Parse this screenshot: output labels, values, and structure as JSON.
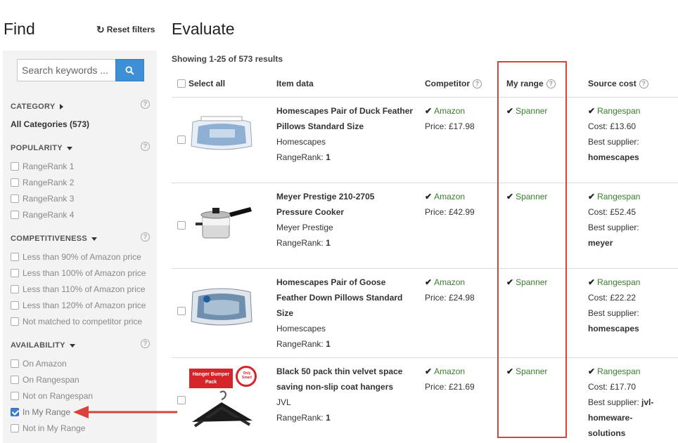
{
  "sidebar": {
    "title": "Find",
    "reset_label": "Reset filters",
    "search_placeholder": "Search keywords ...",
    "category": {
      "heading": "CATEGORY",
      "all": "All Categories (573)"
    },
    "popularity": {
      "heading": "POPULARITY",
      "options": [
        "RangeRank 1",
        "RangeRank 2",
        "RangeRank 3",
        "RangeRank 4"
      ]
    },
    "competitiveness": {
      "heading": "COMPETITIVENESS",
      "options": [
        "Less than 90% of Amazon price",
        "Less than 100% of Amazon price",
        "Less than 110% of Amazon price",
        "Less than 120% of Amazon price",
        "Not matched to competitor price"
      ]
    },
    "availability": {
      "heading": "AVAILABILITY",
      "options": [
        "On Amazon",
        "On Rangespan",
        "Not on Rangespan",
        "In My Range",
        "Not in My Range"
      ]
    },
    "help_glyph": "?"
  },
  "main": {
    "title": "Evaluate",
    "showing": "Showing 1-25 of 573 results",
    "headers": {
      "select_all": "Select all",
      "item_data": "Item data",
      "competitor": "Competitor",
      "my_range": "My range",
      "source_cost": "Source cost"
    },
    "rows": [
      {
        "name_l1": "Homescapes Pair of Duck Feather",
        "name_l2": "Pillows Standard Size",
        "name_l3": "",
        "brand": "Homescapes",
        "rank_label": "RangeRank:",
        "rank": "1",
        "competitor": "Amazon",
        "price": "Price: £17.98",
        "range": "Spanner",
        "source": "Rangespan",
        "cost": "Cost: £13.60",
        "best_label": "Best supplier:",
        "supplier": "homescapes",
        "supplier2": ""
      },
      {
        "name_l1": "Meyer Prestige 210-2705",
        "name_l2": "Pressure Cooker",
        "name_l3": "",
        "brand": "Meyer Prestige",
        "rank_label": "RangeRank:",
        "rank": "1",
        "competitor": "Amazon",
        "price": "Price: £42.99",
        "range": "Spanner",
        "source": "Rangespan",
        "cost": "Cost: £52.45",
        "best_label": "Best supplier:",
        "supplier": "meyer",
        "supplier2": ""
      },
      {
        "name_l1": "Homescapes Pair of Goose",
        "name_l2": "Feather Down Pillows Standard",
        "name_l3": "Size",
        "brand": "Homescapes",
        "rank_label": "RangeRank:",
        "rank": "1",
        "competitor": "Amazon",
        "price": "Price: £24.98",
        "range": "Spanner",
        "source": "Rangespan",
        "cost": "Cost: £22.22",
        "best_label": "Best supplier:",
        "supplier": "homescapes",
        "supplier2": ""
      },
      {
        "name_l1": "Black 50 pack thin velvet space",
        "name_l2": "saving non-slip coat hangers",
        "name_l3": "",
        "brand": "JVL",
        "rank_label": "RangeRank:",
        "rank": "1",
        "competitor": "Amazon",
        "price": "Price: £21.69",
        "range": "Spanner",
        "source": "Rangespan",
        "cost": "Cost: £17.70",
        "best_label": "Best supplier:",
        "supplier": "jvl-",
        "supplier2": "homeware-",
        "supplier3": "solutions"
      }
    ],
    "thumb4_text": {
      "title": "Hanger Bumper Pack",
      "badge": "Only Smart"
    },
    "check_glyph": "✔"
  },
  "colors": {
    "accent": "#3d8fd6",
    "green": "#3a7d2e",
    "highlight": "#d9443a"
  }
}
